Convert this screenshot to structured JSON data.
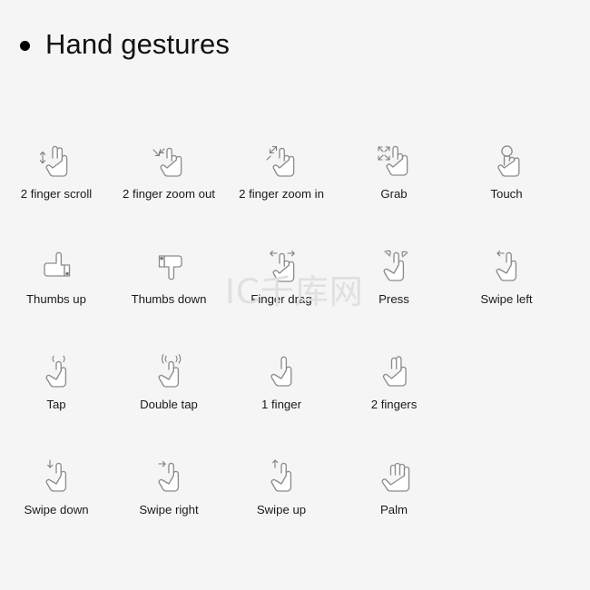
{
  "header": {
    "bullet": "bullet-dot",
    "title": "Hand gestures"
  },
  "watermark": {
    "text": "IC千库网"
  },
  "colors": {
    "background": "#f5f5f5",
    "title_text": "#111111",
    "label_text": "#1a1a1a",
    "icon_stroke": "#8c8c8c",
    "watermark": "#e0e0e0"
  },
  "grid": {
    "rows": [
      {
        "items": [
          {
            "label": "2 finger scroll",
            "icon": "two-finger-scroll-icon"
          },
          {
            "label": "2 finger zoom out",
            "icon": "two-finger-zoom-out-icon"
          },
          {
            "label": "2 finger zoom in",
            "icon": "two-finger-zoom-in-icon"
          },
          {
            "label": "Grab",
            "icon": "grab-icon"
          },
          {
            "label": "Touch",
            "icon": "touch-icon"
          }
        ]
      },
      {
        "items": [
          {
            "label": "Thumbs up",
            "icon": "thumbs-up-icon"
          },
          {
            "label": "Thumbs down",
            "icon": "thumbs-down-icon"
          },
          {
            "label": "Finger drag",
            "icon": "finger-drag-icon"
          },
          {
            "label": "Press",
            "icon": "press-icon"
          },
          {
            "label": "Swipe left",
            "icon": "swipe-left-icon"
          }
        ]
      },
      {
        "items": [
          {
            "label": "Tap",
            "icon": "tap-icon"
          },
          {
            "label": "Double tap",
            "icon": "double-tap-icon"
          },
          {
            "label": "1 finger",
            "icon": "one-finger-icon"
          },
          {
            "label": "2 fingers",
            "icon": "two-fingers-icon"
          }
        ]
      },
      {
        "items": [
          {
            "label": "Swipe down",
            "icon": "swipe-down-icon"
          },
          {
            "label": "Swipe right",
            "icon": "swipe-right-icon"
          },
          {
            "label": "Swipe up",
            "icon": "swipe-up-icon"
          },
          {
            "label": "Palm",
            "icon": "palm-icon"
          }
        ]
      }
    ]
  }
}
